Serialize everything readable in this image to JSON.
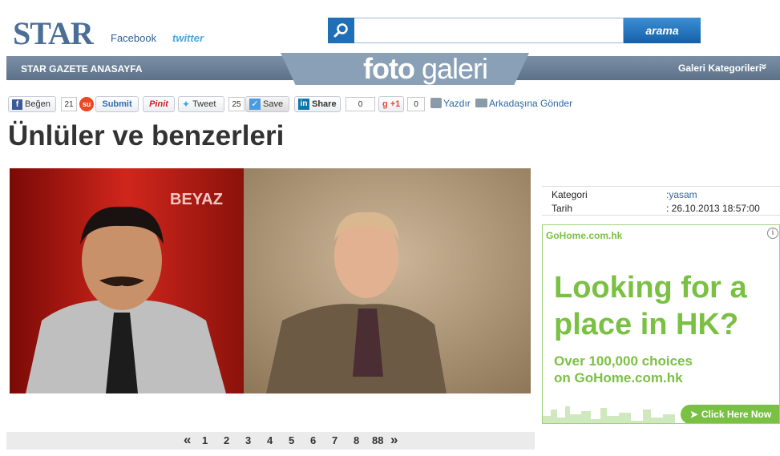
{
  "header": {
    "logo": "STAR",
    "facebook": "Facebook",
    "twitter": "twitter",
    "search_placeholder": "",
    "search_button": "arama"
  },
  "nav": {
    "home": "STAR GAZETE ANASAYFA",
    "galeri_foto": "foto",
    "galeri_word": "galeri",
    "categories": "Galeri Kategorileri",
    "chevron": "»"
  },
  "share": {
    "fb_label": "Beğen",
    "fb_count": "21",
    "stumble_label": "Submit",
    "pin_label": "Pinit",
    "tweet_label": "Tweet",
    "tweet_count": "25",
    "save_label": "Save",
    "linkedin_label": "Share",
    "linkedin_count": "0",
    "gplus_label": "+1",
    "gplus_count": "0",
    "print_label": "Yazdır",
    "email_label": "Arkadaşına Gönder"
  },
  "title": "Ünlüler ve benzerleri",
  "photo": {
    "logo_text": "BEYAZ"
  },
  "info": {
    "category_label": "Kategori",
    "category_value": ":yasam",
    "date_label": "Tarih",
    "date_value": ": 26.10.2013 18:57:00"
  },
  "ad": {
    "brand": "GoHome.com.hk",
    "headline1": "Looking for a",
    "headline2": "place in HK?",
    "sub1": "Over 100,000 choices",
    "sub2": "on GoHome.com.hk",
    "cta": "Click Here Now"
  },
  "pagination": {
    "prev": "«",
    "pages": [
      "1",
      "2",
      "3",
      "4",
      "5",
      "6",
      "7",
      "8",
      "88"
    ],
    "next": "»"
  },
  "colors": {
    "nav_bar": "#6b7f96",
    "search_blue": "#1f6fb7",
    "ad_green": "#7ac143"
  }
}
